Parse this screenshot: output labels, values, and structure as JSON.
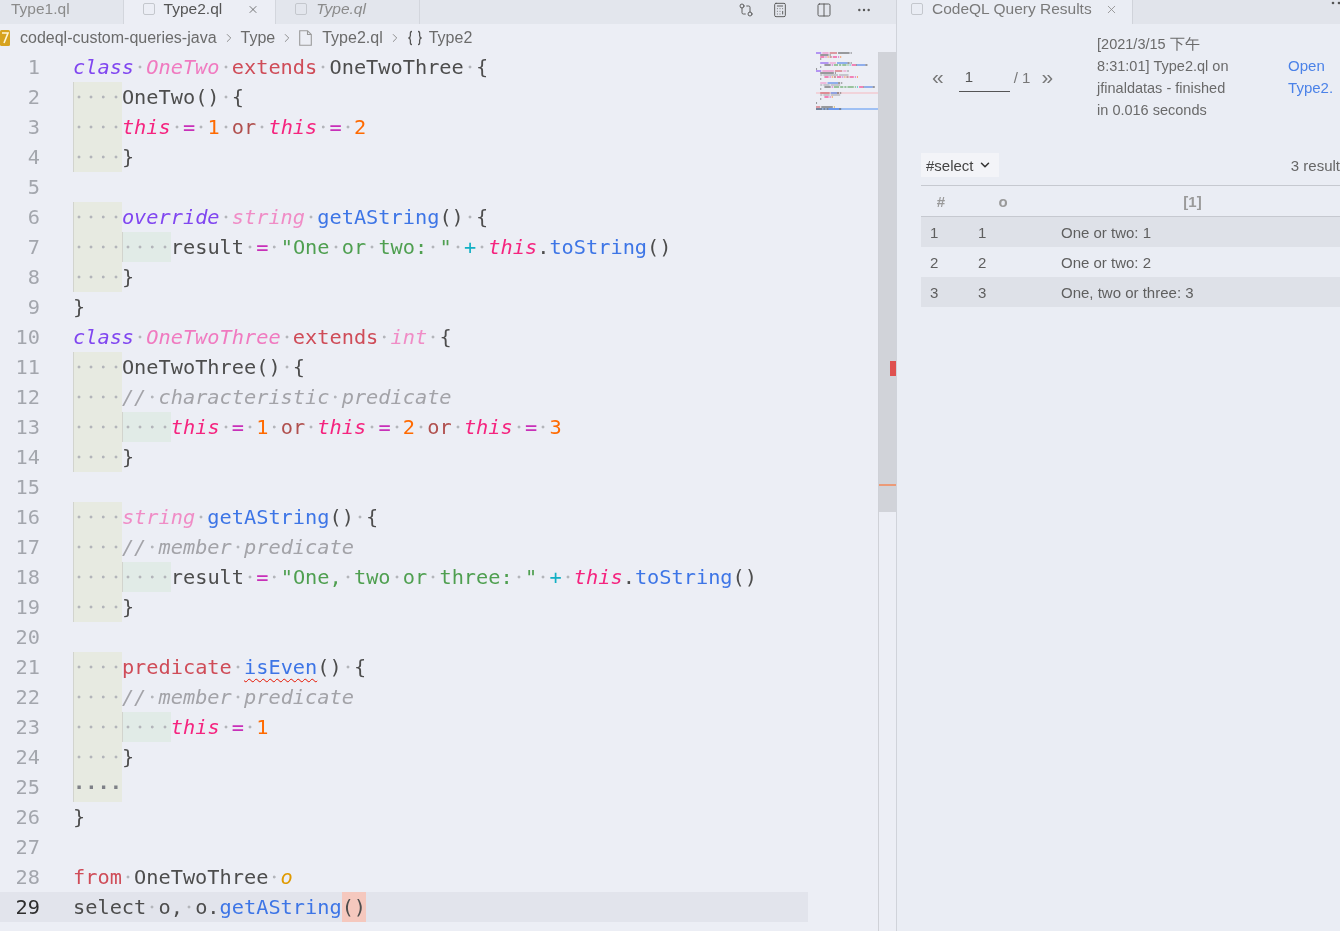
{
  "editor": {
    "tabs": [
      {
        "label": "Type1.ql",
        "selected": false,
        "preview": false,
        "icon": false
      },
      {
        "label": "Type2.ql",
        "selected": true,
        "preview": false,
        "icon": true
      },
      {
        "label": "Type.ql",
        "selected": false,
        "preview": true,
        "icon": true
      }
    ],
    "breadcrumbs": [
      {
        "kind": "project",
        "label": "codeql-custom-queries-java"
      },
      {
        "kind": "folder",
        "label": "Type"
      },
      {
        "kind": "file",
        "label": "Type2.ql"
      },
      {
        "kind": "symbol",
        "label": "Type2"
      }
    ],
    "lines": [
      {
        "number": "1",
        "current": false,
        "tokens": [
          {
            "kind": "keyword",
            "text": "class "
          },
          {
            "kind": "classname",
            "text": "OneTwo "
          },
          {
            "kind": "control",
            "text": "extends "
          },
          {
            "kind": "plain",
            "text": "OneTwoThree {"
          }
        ]
      },
      {
        "number": "2",
        "current": false,
        "tokens": [
          {
            "kind": "plain",
            "text": "    OneTwo() {"
          }
        ]
      },
      {
        "number": "3",
        "current": false,
        "tokens": [
          {
            "kind": "self",
            "text": "    this "
          },
          {
            "kind": "operator",
            "text": "= "
          },
          {
            "kind": "number",
            "text": "1 "
          },
          {
            "kind": "logic",
            "text": "or "
          },
          {
            "kind": "self",
            "text": "this "
          },
          {
            "kind": "operator",
            "text": "= "
          },
          {
            "kind": "number",
            "text": "2"
          }
        ]
      },
      {
        "number": "4",
        "current": false,
        "tokens": [
          {
            "kind": "plain",
            "text": "    }"
          }
        ]
      },
      {
        "number": "5",
        "current": false
      },
      {
        "number": "6",
        "current": false,
        "tokens": [
          {
            "kind": "keyword",
            "text": "    override "
          },
          {
            "kind": "type",
            "text": "string "
          },
          {
            "kind": "function",
            "text": "getAString"
          },
          {
            "kind": "plain",
            "text": "() {"
          }
        ]
      },
      {
        "number": "7",
        "current": false,
        "tokens": [
          {
            "kind": "plain",
            "text": "        result "
          },
          {
            "kind": "operator",
            "text": "= "
          },
          {
            "kind": "string",
            "text": "\"One or two: \" "
          },
          {
            "kind": "concat",
            "text": "+ "
          },
          {
            "kind": "self",
            "text": "this"
          },
          {
            "kind": "plain",
            "text": "."
          },
          {
            "kind": "function",
            "text": "toString"
          },
          {
            "kind": "plain",
            "text": "()"
          }
        ]
      },
      {
        "number": "8",
        "current": false,
        "tokens": [
          {
            "kind": "plain",
            "text": "    }"
          }
        ]
      },
      {
        "number": "9",
        "current": false,
        "tokens": [
          {
            "kind": "plain",
            "text": "}"
          }
        ]
      },
      {
        "number": "10",
        "current": false,
        "tokens": [
          {
            "kind": "keyword",
            "text": "class "
          },
          {
            "kind": "classname",
            "text": "OneTwoThree "
          },
          {
            "kind": "control",
            "text": "extends "
          },
          {
            "kind": "type",
            "text": "int "
          },
          {
            "kind": "plain",
            "text": "{"
          }
        ]
      },
      {
        "number": "11",
        "current": false,
        "tokens": [
          {
            "kind": "plain",
            "text": "    OneTwoThree() {"
          }
        ]
      },
      {
        "number": "12",
        "current": false,
        "tokens": [
          {
            "kind": "comment",
            "text": "    // characteristic predicate"
          }
        ]
      },
      {
        "number": "13",
        "current": false,
        "tokens": [
          {
            "kind": "self",
            "text": "        this "
          },
          {
            "kind": "operator",
            "text": "= "
          },
          {
            "kind": "number",
            "text": "1 "
          },
          {
            "kind": "logic",
            "text": "or "
          },
          {
            "kind": "self",
            "text": "this "
          },
          {
            "kind": "operator",
            "text": "= "
          },
          {
            "kind": "number",
            "text": "2 "
          },
          {
            "kind": "logic",
            "text": "or "
          },
          {
            "kind": "self",
            "text": "this "
          },
          {
            "kind": "operator",
            "text": "= "
          },
          {
            "kind": "number",
            "text": "3"
          }
        ]
      },
      {
        "number": "14",
        "current": false,
        "tokens": [
          {
            "kind": "plain",
            "text": "    }"
          }
        ]
      },
      {
        "number": "15",
        "current": false
      },
      {
        "number": "16",
        "current": false,
        "tokens": [
          {
            "kind": "type",
            "text": "    string "
          },
          {
            "kind": "function",
            "text": "getAString"
          },
          {
            "kind": "plain",
            "text": "() {"
          }
        ]
      },
      {
        "number": "17",
        "current": false,
        "tokens": [
          {
            "kind": "comment",
            "text": "    // member predicate"
          }
        ]
      },
      {
        "number": "18",
        "current": false,
        "tokens": [
          {
            "kind": "plain",
            "text": "        result "
          },
          {
            "kind": "operator",
            "text": "= "
          },
          {
            "kind": "string",
            "text": "\"One, two or three: \" "
          },
          {
            "kind": "concat",
            "text": "+ "
          },
          {
            "kind": "self",
            "text": "this"
          },
          {
            "kind": "plain",
            "text": "."
          },
          {
            "kind": "function",
            "text": "toString"
          },
          {
            "kind": "plain",
            "text": "()"
          }
        ]
      },
      {
        "number": "19",
        "current": false,
        "tokens": [
          {
            "kind": "plain",
            "text": "    }"
          }
        ]
      },
      {
        "number": "20",
        "current": false
      },
      {
        "number": "21",
        "current": false,
        "tokens": [
          {
            "kind": "control",
            "text": "    predicate "
          },
          {
            "kind": "flagged",
            "text": "isEven"
          },
          {
            "kind": "plain",
            "text": "() {"
          }
        ]
      },
      {
        "number": "22",
        "current": false,
        "tokens": [
          {
            "kind": "comment",
            "text": "    // member predicate"
          }
        ]
      },
      {
        "number": "23",
        "current": false,
        "tokens": [
          {
            "kind": "self",
            "text": "        this "
          },
          {
            "kind": "operator",
            "text": "= "
          },
          {
            "kind": "number",
            "text": "1"
          }
        ]
      },
      {
        "number": "24",
        "current": false,
        "tokens": [
          {
            "kind": "plain",
            "text": "    }"
          }
        ]
      },
      {
        "number": "25",
        "current": false,
        "tokens": [
          {
            "kind": "plain",
            "text": "····"
          }
        ]
      },
      {
        "number": "26",
        "current": false,
        "tokens": [
          {
            "kind": "plain",
            "text": "}"
          }
        ]
      },
      {
        "number": "27",
        "current": false
      },
      {
        "number": "28",
        "current": false,
        "tokens": [
          {
            "kind": "control",
            "text": "from "
          },
          {
            "kind": "plain",
            "text": "OneTwoThree "
          },
          {
            "kind": "variable",
            "text": "o"
          }
        ]
      },
      {
        "number": "29",
        "current": true,
        "tokens": [
          {
            "kind": "plain",
            "text": "select o, o."
          },
          {
            "kind": "function",
            "text": "getAString"
          },
          {
            "kind": "bracket",
            "text": "()"
          }
        ]
      }
    ]
  },
  "results": {
    "tab": {
      "label": "CodeQL Query Results",
      "selected": true
    },
    "pager": {
      "previous": "«",
      "page": "1",
      "total": "/ 1",
      "next": "»"
    },
    "summary": "[2021/3/15 下午 8:31:01] Type2.ql on jfinaldatas - finished in 0.016 seconds",
    "link": "Open Type2.",
    "result_set": "#select",
    "count": "3 result",
    "columns": [
      "#",
      "o",
      "[1]"
    ],
    "rows": [
      [
        "1",
        "1",
        "One or two: 1"
      ],
      [
        "2",
        "2",
        "One or two: 2"
      ],
      [
        "3",
        "3",
        "One, two or three: 3"
      ]
    ]
  }
}
